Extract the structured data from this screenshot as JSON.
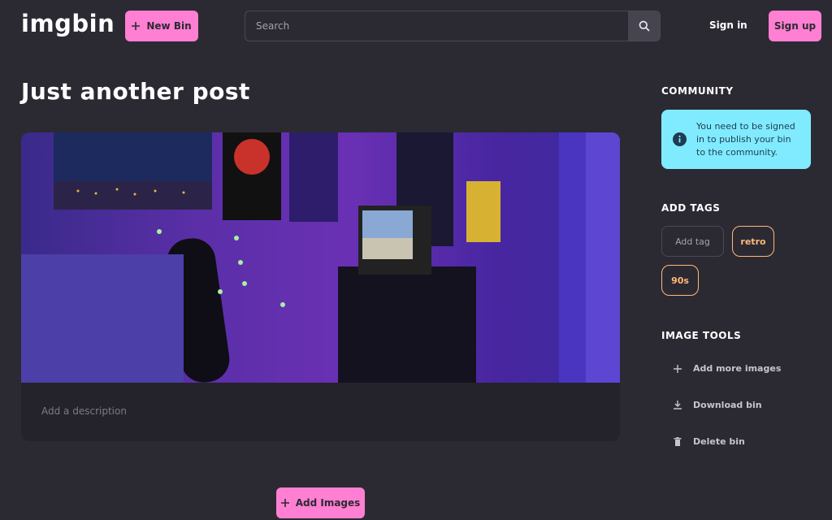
{
  "header": {
    "logo": "imgbin",
    "new_bin_label": "New Bin",
    "search_placeholder": "Search",
    "sign_in_label": "Sign in",
    "sign_up_label": "Sign up"
  },
  "main": {
    "title": "Just another post",
    "description_placeholder": "Add a description",
    "add_images_label": "Add Images"
  },
  "sidebar": {
    "community_heading": "COMMUNITY",
    "community_notice": "You need to be signed in to publish your bin to the community.",
    "tags_heading": "ADD TAGS",
    "tag_input_placeholder": "Add tag",
    "tags": [
      "retro",
      "90s"
    ],
    "tools_heading": "IMAGE TOOLS",
    "tools": [
      {
        "label": "Add more images",
        "icon": "plus-icon"
      },
      {
        "label": "Download bin",
        "icon": "download-icon"
      },
      {
        "label": "Delete bin",
        "icon": "trash-icon"
      }
    ]
  },
  "colors": {
    "background": "#2b2a33",
    "accent_pink": "#ff7fd2",
    "info_cyan": "#80ebff",
    "tag_orange": "#ffb87a"
  }
}
